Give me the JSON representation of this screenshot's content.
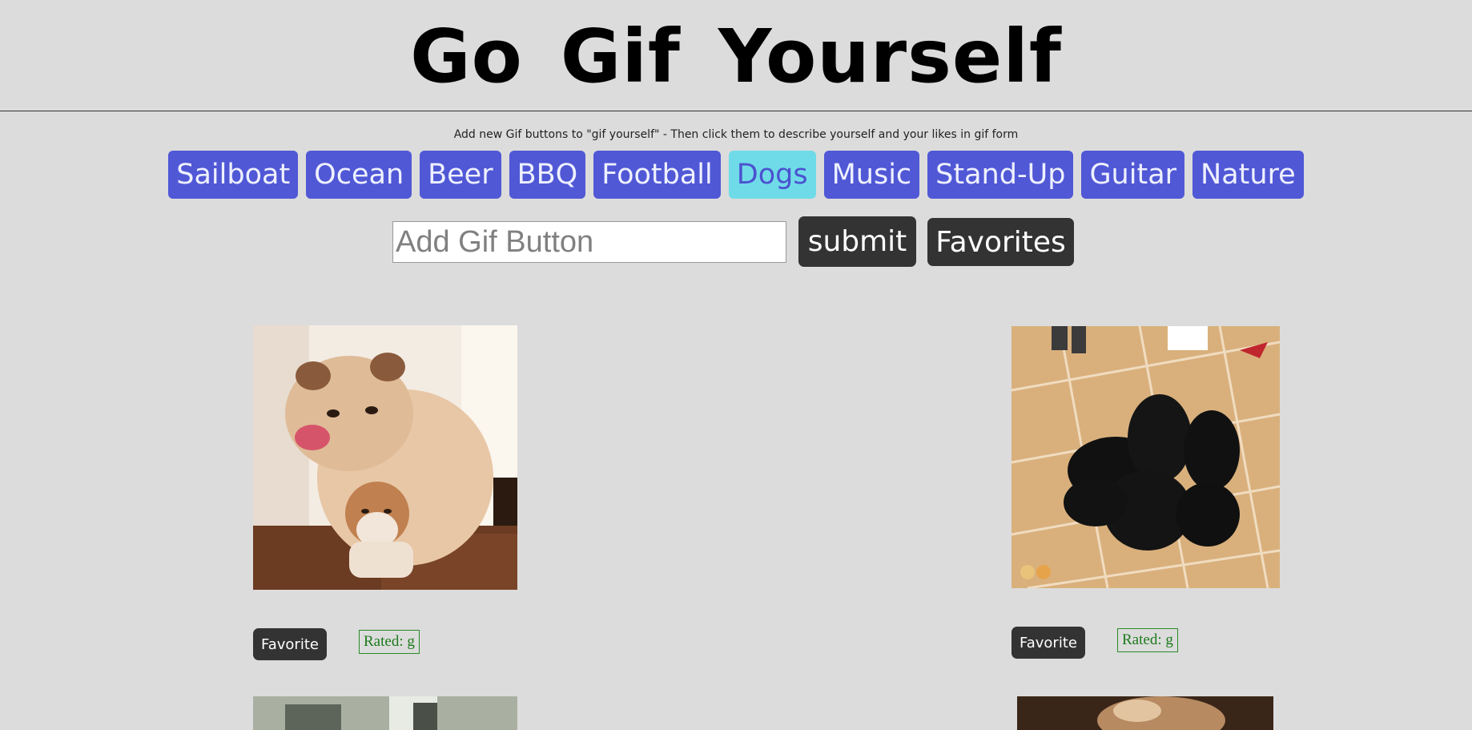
{
  "header": {
    "title": "Go Gif Yourself"
  },
  "subtitle": "Add new Gif buttons to \"gif yourself\" - Then click them to describe yourself and your likes in gif form",
  "topics": [
    {
      "label": "Sailboat",
      "active": false
    },
    {
      "label": "Ocean",
      "active": false
    },
    {
      "label": "Beer",
      "active": false
    },
    {
      "label": "BBQ",
      "active": false
    },
    {
      "label": "Football",
      "active": false
    },
    {
      "label": "Dogs",
      "active": true
    },
    {
      "label": "Music",
      "active": false
    },
    {
      "label": "Stand-Up",
      "active": false
    },
    {
      "label": "Guitar",
      "active": false
    },
    {
      "label": "Nature",
      "active": false
    }
  ],
  "form": {
    "input_placeholder": "Add Gif Button",
    "input_value": "",
    "submit_label": "submit",
    "favorites_label": "Favorites"
  },
  "gifs": [
    {
      "favorite_label": "Favorite",
      "rating": "Rated: g"
    },
    {
      "favorite_label": "Favorite",
      "rating": "Rated: g"
    }
  ],
  "colors": {
    "background": "#dcdcdc",
    "topic_button": "#5058d6",
    "topic_active": "#6fdbe8",
    "dark_button": "#333333",
    "rating_green": "#1c7a1c"
  }
}
